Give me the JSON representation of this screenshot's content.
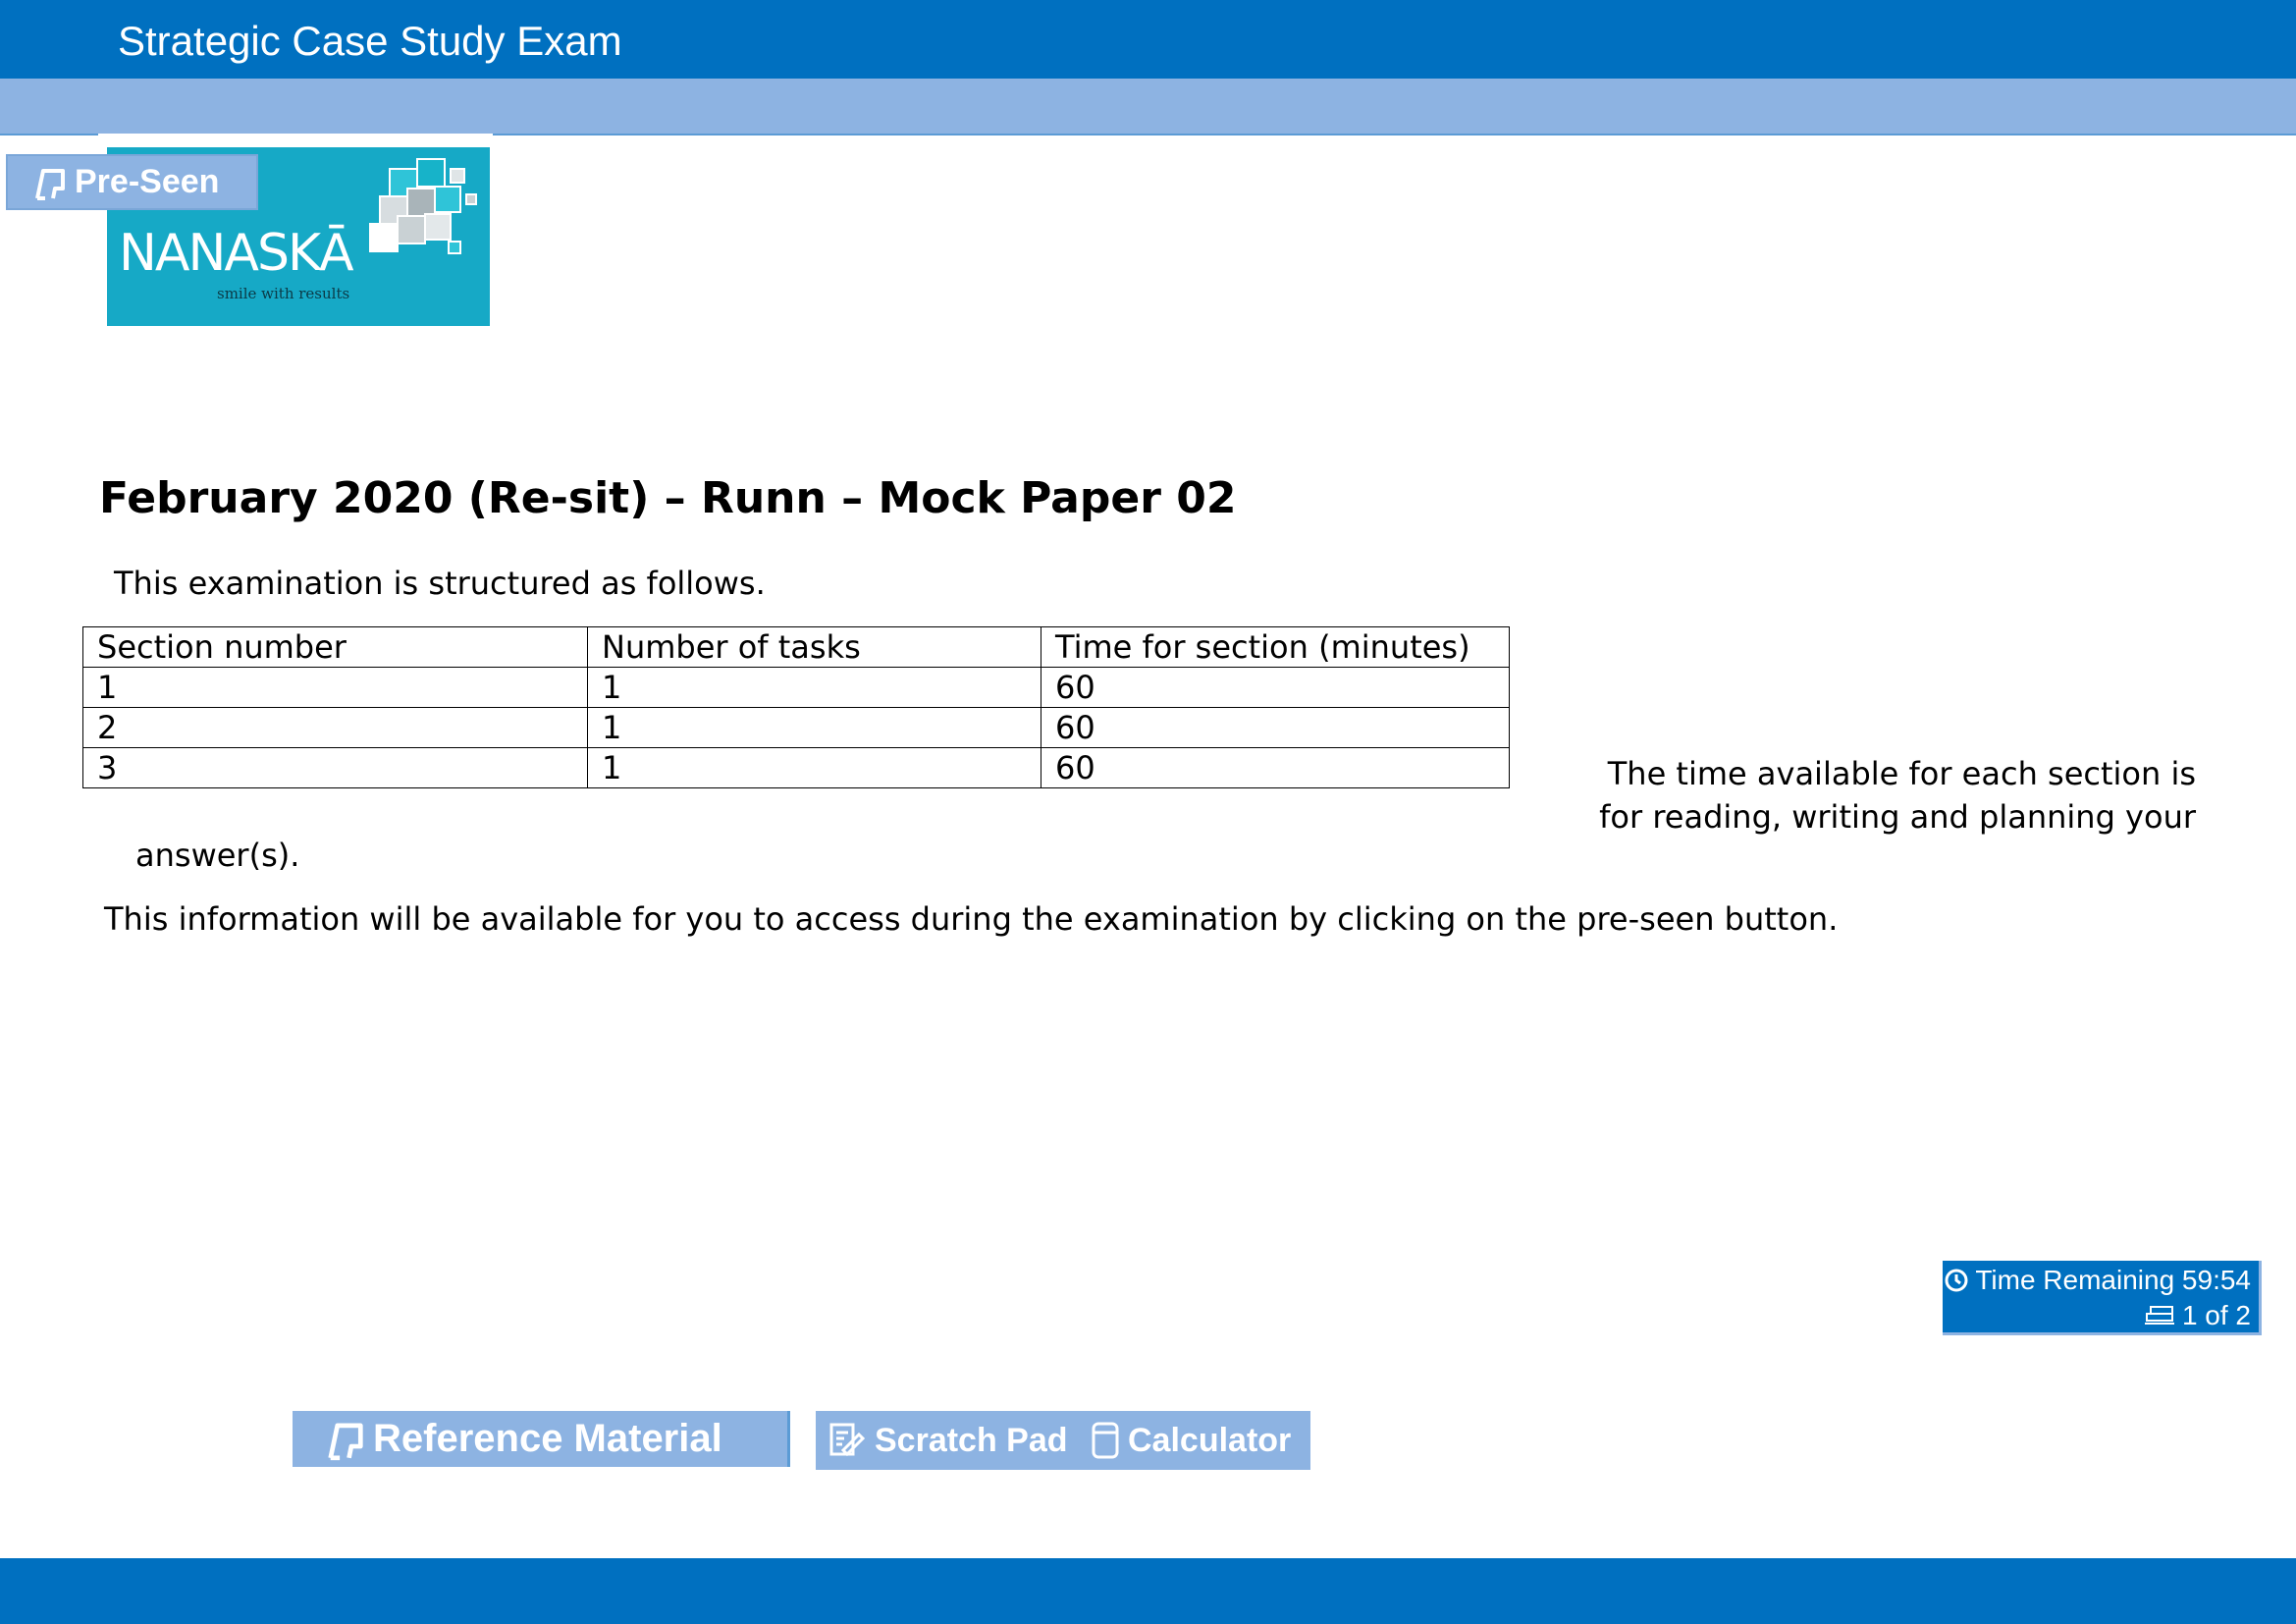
{
  "header": {
    "title": "Strategic Case Study Exam"
  },
  "preseen": {
    "label": "Pre-Seen",
    "icon": "book-stand-icon"
  },
  "logo": {
    "brand": "NANASKĀ",
    "tagline": "smile with results"
  },
  "main": {
    "heading": "February 2020 (Re-sit) – Runn – Mock Paper 02",
    "intro": "This examination is structured as follows.",
    "table": {
      "headers": [
        "Section number",
        "Number of tasks",
        "Time for section (minutes)"
      ],
      "rows": [
        [
          "1",
          "1",
          "60"
        ],
        [
          "2",
          "1",
          "60"
        ],
        [
          "3",
          "1",
          "60"
        ]
      ]
    },
    "note_line1": "The time available for each section is",
    "note_line2": "for reading, writing and planning your",
    "note_line3": "answer(s).",
    "access_note": "This information will be available for you to access during the examination by clicking on the pre-seen button."
  },
  "timer": {
    "label": "Time Remaining 59:54",
    "page": "1 of 2",
    "icon": "clock-icon",
    "page_icon": "pages-icon"
  },
  "toolbar": {
    "reference_label": "Reference Material",
    "scratch_label": "Scratch Pad",
    "calculator_label": "Calculator"
  },
  "colors": {
    "primary": "#0070c0",
    "light": "#8db3e2",
    "logo_bg": "#16a9c6"
  }
}
